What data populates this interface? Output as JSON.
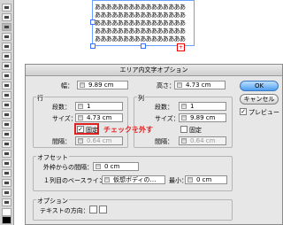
{
  "document_text": {
    "line1": "ああああああああああああああああ",
    "line2": "ああああああああああああああああ",
    "line3": "ああああああああああああああああ",
    "line4": "ああああああああああああああああ",
    "line5": "ああああああああああああああああ"
  },
  "dialog": {
    "title": "エリア内文字オプション",
    "width_label": "幅：",
    "width_value": "9.89 cm",
    "height_label": "高さ：",
    "height_value": "4.73 cm",
    "ok_label": "OK",
    "cancel_label": "キャンセル",
    "preview_label": "プレビュー",
    "preview_checked": "✓",
    "rows": {
      "group_label": "行",
      "count_label": "段数：",
      "count_value": "1",
      "size_label": "サイズ：",
      "size_value": "4.73 cm",
      "fixed_label": "固定",
      "fixed_checked": "✓",
      "gutter_label": "間隔：",
      "gutter_value": "0.64 cm"
    },
    "columns": {
      "group_label": "列",
      "count_label": "段数：",
      "count_value": "1",
      "size_label": "サイズ：",
      "size_value": "9.89 cm",
      "fixed_label": "固定",
      "gutter_label": "間隔：",
      "gutter_value": "0.64 cm"
    },
    "offset": {
      "group_label": "オフセット",
      "inset_label": "外枠からの間隔：",
      "inset_value": "0 cm",
      "baseline_label": "１列目のベースライン：",
      "baseline_value": "仮想ボディの…",
      "min_label": "最小：",
      "min_value": "0 cm"
    },
    "options": {
      "group_label": "オプション",
      "flow_label": "テキストの方向："
    }
  },
  "annotation": {
    "text": "チェックを外す",
    "color": "#e02020"
  }
}
